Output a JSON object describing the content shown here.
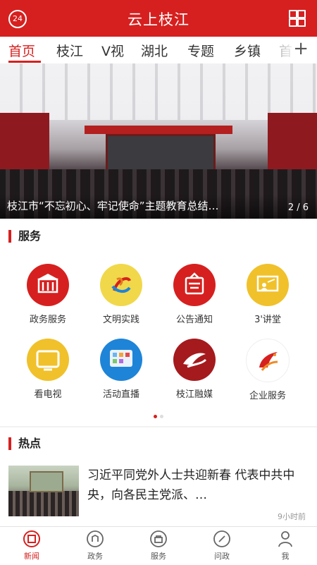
{
  "header": {
    "title": "云上枝江",
    "badge": "24"
  },
  "tabs": [
    "首页",
    "枝江",
    "V视",
    "湖北",
    "专题",
    "乡镇",
    "首"
  ],
  "banner": {
    "caption": "枝江市“不忘初心、牢记使命”主题教育总结…",
    "pager": "2 / 6"
  },
  "services": {
    "title": "服务",
    "items": [
      {
        "label": "政务服务",
        "icon": "government-building-icon",
        "color": "#d6201f"
      },
      {
        "label": "文明实践",
        "icon": "civilization-logo-icon",
        "color": "#f1d84a"
      },
      {
        "label": "公告通知",
        "icon": "notice-board-icon",
        "color": "#d6201f"
      },
      {
        "label": "3'讲堂",
        "icon": "lecture-board-icon",
        "color": "#f0c12a"
      },
      {
        "label": "看电视",
        "icon": "tv-icon",
        "color": "#f0c12a"
      },
      {
        "label": "活动直播",
        "icon": "tablet-live-icon",
        "color": "#1e84d8"
      },
      {
        "label": "枝江融媒",
        "icon": "zhijiang-media-logo-icon",
        "color": "#a51a1d"
      },
      {
        "label": "企业服务",
        "icon": "phoenix-logo-icon",
        "color": "#ffffff"
      }
    ]
  },
  "hot": {
    "title": "热点",
    "news": {
      "title": "习近平同党外人士共迎新春 代表中共中央，向各民主党派、…",
      "time": "9小时前"
    }
  },
  "nav": [
    {
      "label": "新闻",
      "icon": "news-icon"
    },
    {
      "label": "政务",
      "icon": "government-icon"
    },
    {
      "label": "服务",
      "icon": "bag-icon"
    },
    {
      "label": "问政",
      "icon": "compass-icon"
    },
    {
      "label": "我",
      "icon": "user-icon"
    }
  ]
}
